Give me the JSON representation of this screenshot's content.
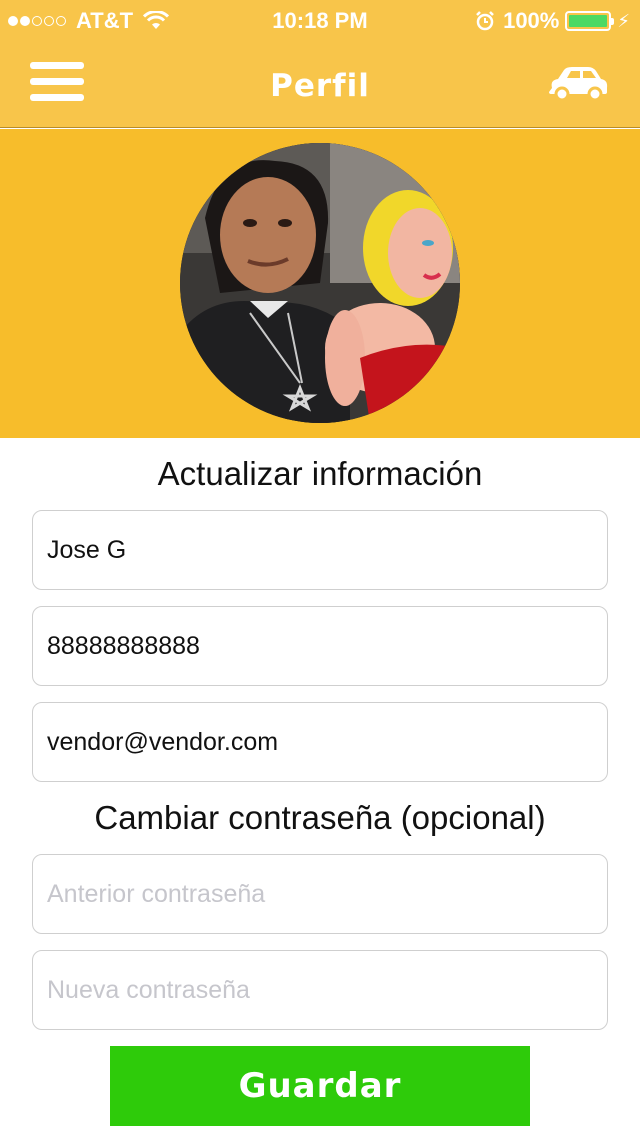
{
  "status_bar": {
    "signal_filled": 2,
    "signal_total": 5,
    "carrier": "AT&T",
    "time": "10:18 PM",
    "battery_pct": "100%",
    "battery_level": 1.0,
    "battery_color": "#4cd964"
  },
  "nav": {
    "title": "Perfil",
    "menu_icon": "hamburger-menu-icon",
    "right_icon": "car-icon"
  },
  "profile": {
    "banner_color": "#f7bd2b"
  },
  "form": {
    "update_title": "Actualizar información",
    "name_value": "Jose G",
    "phone_value": "88888888888",
    "email_value": "vendor@vendor.com",
    "password_title": "Cambiar contraseña (opcional)",
    "old_password_placeholder": "Anterior contraseña",
    "new_password_placeholder": "Nueva contraseña",
    "save_label": "Guardar"
  },
  "colors": {
    "header": "#f8c54a",
    "save_button": "#2ecb0a"
  }
}
